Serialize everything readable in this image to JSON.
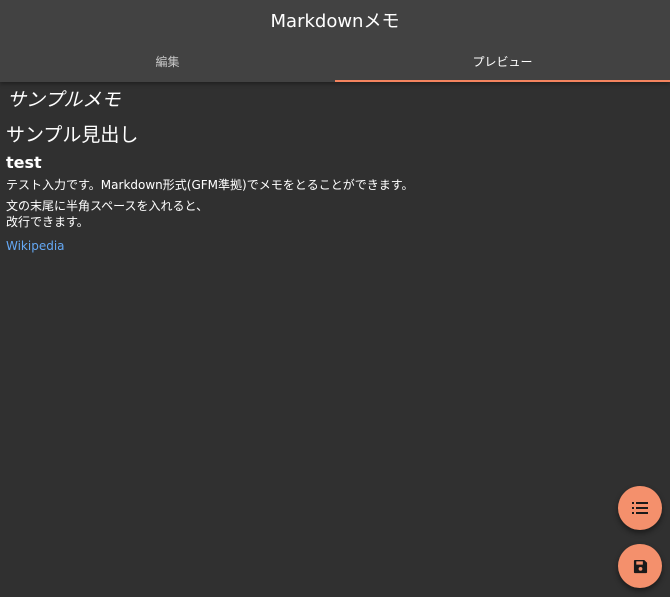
{
  "appbar": {
    "title": "Markdownメモ",
    "tabs": [
      {
        "label": "編集",
        "active": false
      },
      {
        "label": "プレビュー",
        "active": true
      }
    ],
    "accent_color": "#f4845f"
  },
  "preview": {
    "memo_title": "サンプルメモ",
    "heading2": "サンプル見出し",
    "heading3": "test",
    "paragraph1": "テスト入力です。Markdown形式(GFM準拠)でメモをとることができます。",
    "paragraph2_line1": "文の末尾に半角スペースを入れると、",
    "paragraph2_line2": "改行できます。",
    "link_text": "Wikipedia"
  },
  "fabs": {
    "list_icon": "list-icon",
    "save_icon": "save-icon",
    "color": "#f4906c"
  }
}
